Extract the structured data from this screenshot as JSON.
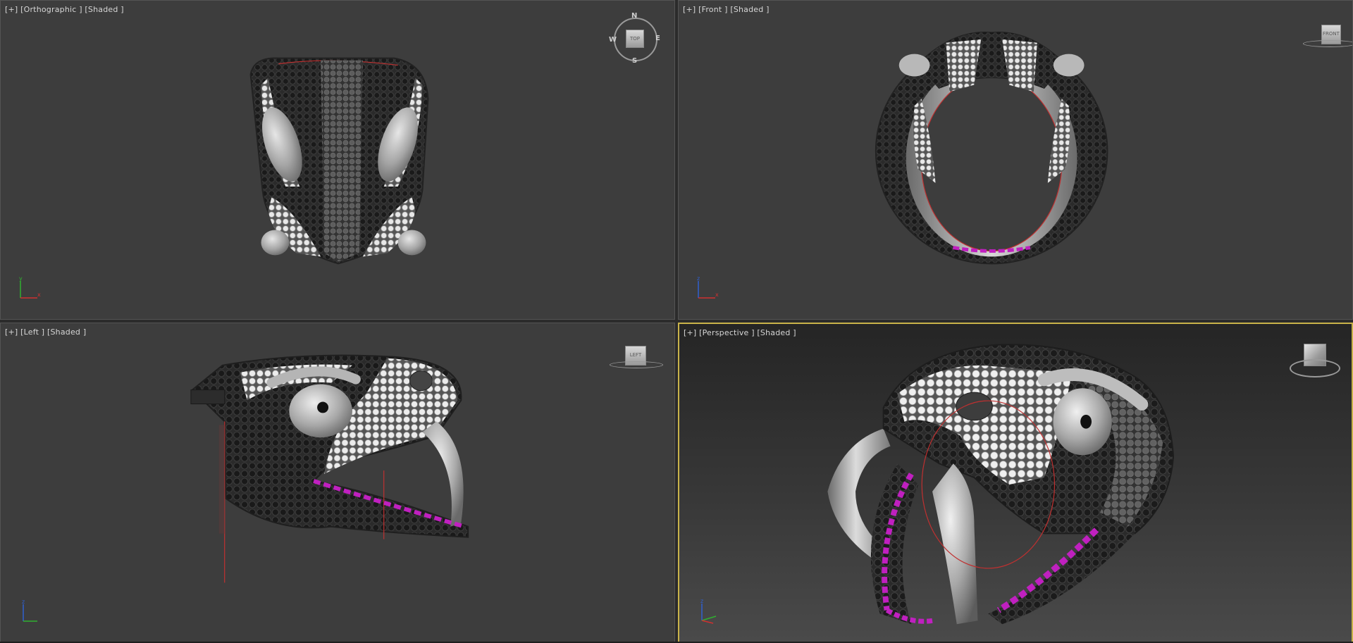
{
  "viewports": {
    "top_left": {
      "bracket_plus": "[+]",
      "view": "[Orthographic ]",
      "shading": "[Shaded ]",
      "nav": {
        "type": "compass",
        "face": "TOP",
        "north": "N",
        "south": "S",
        "east": "E",
        "west": "W"
      }
    },
    "top_right": {
      "bracket_plus": "[+]",
      "view": "[Front ]",
      "shading": "[Shaded ]",
      "nav": {
        "type": "cube",
        "face": "FRONT"
      }
    },
    "bottom_left": {
      "bracket_plus": "[+]",
      "view": "[Left ]",
      "shading": "[Shaded ]",
      "nav": {
        "type": "cube",
        "face": "LEFT"
      }
    },
    "bottom_right": {
      "bracket_plus": "[+]",
      "view": "[Perspective ]",
      "shading": "[Shaded ]",
      "active": true,
      "nav": {
        "type": "cube3d",
        "face": ""
      }
    }
  },
  "axis_labels": {
    "x": "x",
    "y": "y",
    "z": "z"
  },
  "colors": {
    "viewport_bg": "#3d3d3d",
    "active_border": "#c9b34a",
    "axis_x": "#d03030",
    "axis_y": "#30b030",
    "axis_z": "#3060d0",
    "gem_magenta": "#c020c0",
    "gem_black": "#1c1c1c",
    "gem_white": "#e6e6e6",
    "metal": "#a8a8a8"
  }
}
